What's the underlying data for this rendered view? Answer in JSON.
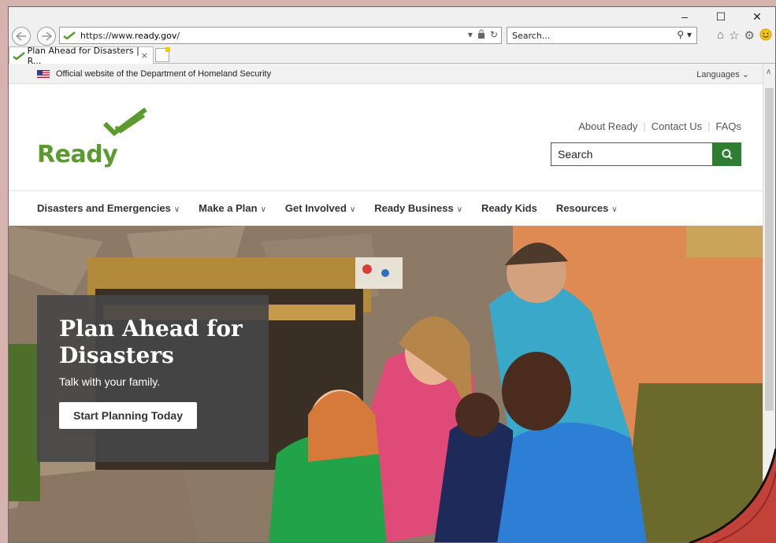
{
  "browser": {
    "url_prefix": "https://www.",
    "url_domain": "ready.gov",
    "url_suffix": "/",
    "search_placeholder": "Search...",
    "tab_title": "Plan Ahead for Disasters | R...",
    "tab_close": "×",
    "caption": {
      "minimize": "–",
      "maximize": "☐",
      "close": "✕"
    }
  },
  "gov_banner": {
    "text": "Official website of the Department of Homeland Security",
    "languages": "Languages ⌄"
  },
  "header": {
    "logo_text": "Ready",
    "util_links": [
      "About Ready",
      "Contact Us",
      "FAQs"
    ],
    "search_placeholder": "Search"
  },
  "nav": {
    "items": [
      {
        "label": "Disasters and Emergencies",
        "dropdown": true
      },
      {
        "label": "Make a Plan",
        "dropdown": true
      },
      {
        "label": "Get Involved",
        "dropdown": true
      },
      {
        "label": "Ready Business",
        "dropdown": true
      },
      {
        "label": "Ready Kids",
        "dropdown": false
      },
      {
        "label": "Resources",
        "dropdown": true
      }
    ]
  },
  "hero": {
    "title": "Plan Ahead for Disasters",
    "subtitle": "Talk with your family.",
    "cta": "Start Planning Today"
  },
  "colors": {
    "brand_green": "#5a9a2e",
    "search_button": "#2e7d32",
    "callout_bg": "#464646"
  },
  "icons": [
    "back-icon",
    "forward-icon",
    "verified-check-icon",
    "lock-icon",
    "refresh-icon",
    "search-icon",
    "home-icon",
    "favorites-icon",
    "settings-icon",
    "smiley-icon",
    "flag-icon",
    "new-tab-icon"
  ]
}
